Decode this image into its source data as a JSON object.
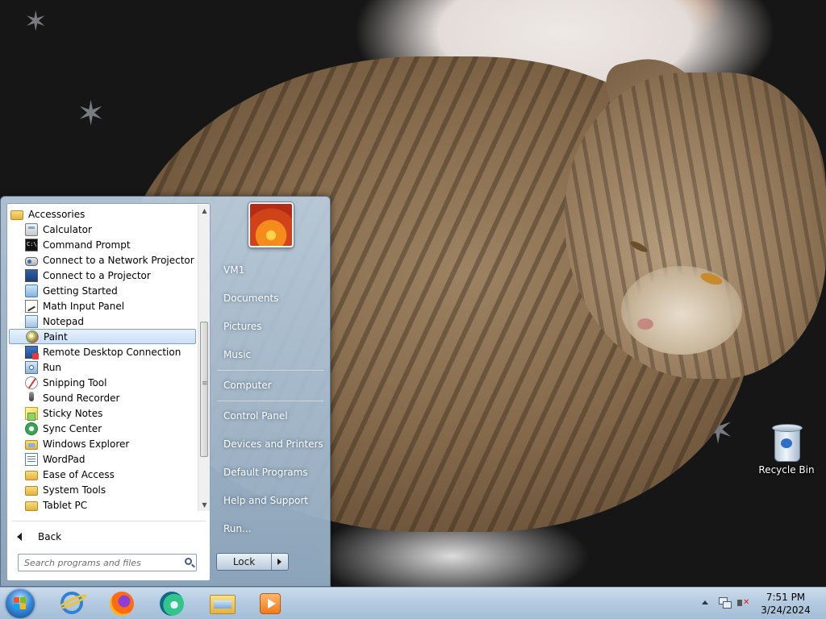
{
  "desktop": {
    "icons": [
      {
        "label": "Recycle Bin",
        "icon": "recycle-bin-icon"
      }
    ]
  },
  "start_menu": {
    "programs": [
      {
        "label": "Accessories",
        "icon": "folder-icon",
        "indent": 0
      },
      {
        "label": "Calculator",
        "icon": "calculator-icon",
        "indent": 1
      },
      {
        "label": "Command Prompt",
        "icon": "command-prompt-icon",
        "indent": 1
      },
      {
        "label": "Connect to a Network Projector",
        "icon": "network-projector-icon",
        "indent": 1
      },
      {
        "label": "Connect to a Projector",
        "icon": "projector-icon",
        "indent": 1
      },
      {
        "label": "Getting Started",
        "icon": "getting-started-icon",
        "indent": 1
      },
      {
        "label": "Math Input Panel",
        "icon": "math-input-icon",
        "indent": 1
      },
      {
        "label": "Notepad",
        "icon": "notepad-icon",
        "indent": 1
      },
      {
        "label": "Paint",
        "icon": "paint-icon",
        "indent": 1,
        "selected": true
      },
      {
        "label": "Remote Desktop Connection",
        "icon": "remote-desktop-icon",
        "indent": 1
      },
      {
        "label": "Run",
        "icon": "run-icon",
        "indent": 1
      },
      {
        "label": "Snipping Tool",
        "icon": "snipping-tool-icon",
        "indent": 1
      },
      {
        "label": "Sound Recorder",
        "icon": "microphone-icon",
        "indent": 1
      },
      {
        "label": "Sticky Notes",
        "icon": "sticky-notes-icon",
        "indent": 1
      },
      {
        "label": "Sync Center",
        "icon": "sync-icon",
        "indent": 1
      },
      {
        "label": "Windows Explorer",
        "icon": "explorer-icon",
        "indent": 1
      },
      {
        "label": "WordPad",
        "icon": "wordpad-icon",
        "indent": 1
      },
      {
        "label": "Ease of Access",
        "icon": "folder-icon",
        "indent": 1
      },
      {
        "label": "System Tools",
        "icon": "folder-icon",
        "indent": 1
      },
      {
        "label": "Tablet PC",
        "icon": "folder-icon",
        "indent": 1
      }
    ],
    "back_label": "Back",
    "search_placeholder": "Search programs and files",
    "right_links": [
      {
        "label": "VM1"
      },
      {
        "label": "Documents"
      },
      {
        "label": "Pictures"
      },
      {
        "label": "Music"
      },
      {
        "label": "Computer"
      },
      {
        "label": "Control Panel"
      },
      {
        "label": "Devices and Printers"
      },
      {
        "label": "Default Programs"
      },
      {
        "label": "Help and Support"
      },
      {
        "label": "Run..."
      }
    ],
    "lock_label": "Lock"
  },
  "taskbar": {
    "pinned": [
      {
        "icon": "internet-explorer-icon"
      },
      {
        "icon": "firefox-icon"
      },
      {
        "icon": "edge-icon"
      },
      {
        "icon": "windows-explorer-icon"
      },
      {
        "icon": "media-player-icon"
      }
    ],
    "clock": {
      "time": "7:51 PM",
      "date": "3/24/2024"
    }
  }
}
